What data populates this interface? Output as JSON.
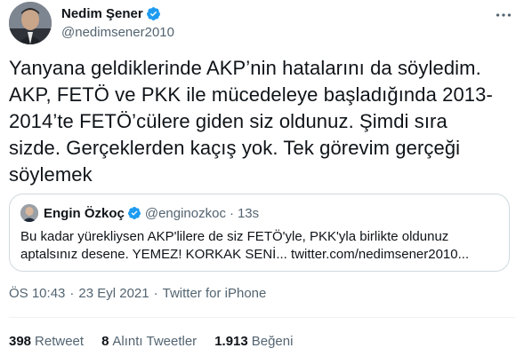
{
  "author": {
    "name": "Nedim Şener",
    "handle": "@nedimsener2010"
  },
  "tweet": {
    "lines": [
      "Yanyana geldiklerinde AKP’nin hatalarını da söyledim.",
      "AKP, FETÖ ve PKK ile mücedeleye başladığında 2013-",
      "2014’te FETÖ’cülere giden siz oldunuz. Şimdi sıra",
      "sizde. Gerçeklerden kaçış yok. Tek görevim gerçeği",
      "söylemek"
    ]
  },
  "quote": {
    "name": "Engin Özkoç",
    "handle": "@enginozkoc",
    "dot": "·",
    "time": "13s",
    "lines": [
      "Bu kadar yürekliysen AKP'lilere de siz FETÖ'yle, PKK'yla birlikte oldunuz",
      "aptalsınız desene. YEMEZ! KORKAK SENİ... twitter.com/nedimsener2010..."
    ]
  },
  "meta": {
    "time": "ÖS 10:43",
    "sep1": "·",
    "date": "23 Eyl 2021",
    "sep2": "·",
    "source": "Twitter for iPhone"
  },
  "stats": {
    "retweets": {
      "count": "398",
      "label": "Retweet"
    },
    "quotes": {
      "count": "8",
      "label": "Alıntı Tweetler"
    },
    "likes": {
      "count": "1.913",
      "label": "Beğeni"
    }
  },
  "colors": {
    "verified": "#1d9bf0",
    "secondary_text": "#536471",
    "border": "#cfd9de"
  },
  "icons": {
    "verified": "verified-badge-icon",
    "more": "more-options-icon"
  }
}
